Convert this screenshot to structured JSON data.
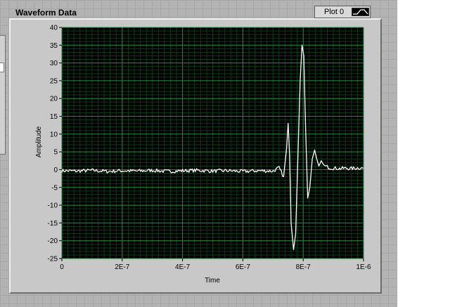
{
  "window": {
    "graph_title": "Waveform Data",
    "legend_label": "Plot 0"
  },
  "colors": {
    "plot_bg": "#000000",
    "major_grid": "#1f8a3a",
    "minor_grid": "#0b3a18",
    "trace": "#ffffff"
  },
  "chart_data": {
    "type": "line",
    "title": "Waveform Data",
    "xlabel": "Time",
    "ylabel": "Amplitude",
    "xlim": [
      0,
      1e-06
    ],
    "ylim": [
      -25,
      40
    ],
    "grid": true,
    "legend": "top-right",
    "x_ticks": [
      0,
      2e-07,
      4e-07,
      6e-07,
      8e-07,
      1e-06
    ],
    "x_tick_labels": [
      "0",
      "2E-7",
      "4E-7",
      "6E-7",
      "8E-7",
      "1E-6"
    ],
    "y_ticks": [
      40,
      35,
      30,
      25,
      20,
      15,
      10,
      5,
      0,
      -5,
      -10,
      -15,
      -20,
      -25
    ],
    "y_tick_labels": [
      "40",
      "35",
      "30",
      "25",
      "20",
      "15",
      "10",
      "5",
      "0",
      "-5",
      "-10",
      "-15",
      "-20",
      "-25"
    ],
    "series": [
      {
        "name": "Plot 0",
        "x": [
          0,
          5e-08,
          1e-07,
          1.5e-07,
          2e-07,
          2.5e-07,
          3e-07,
          3.5e-07,
          4e-07,
          4.5e-07,
          5e-07,
          5.5e-07,
          6e-07,
          6.5e-07,
          7e-07,
          7.2e-07,
          7.35e-07,
          7.45e-07,
          7.5e-07,
          7.55e-07,
          7.6e-07,
          7.68e-07,
          7.75e-07,
          7.83e-07,
          7.9e-07,
          7.96e-07,
          8.02e-07,
          8.08e-07,
          8.15e-07,
          8.22e-07,
          8.3e-07,
          8.38e-07,
          8.45e-07,
          8.52e-07,
          8.6e-07,
          8.7e-07,
          8.8e-07,
          8.9e-07,
          9e-07,
          9.2e-07,
          9.4e-07,
          9.6e-07,
          9.8e-07,
          1e-06
        ],
        "y": [
          -0.3,
          -0.4,
          -0.2,
          -0.5,
          -0.3,
          -0.4,
          -0.2,
          -0.5,
          -0.3,
          -0.2,
          -0.4,
          -0.3,
          -0.5,
          -0.3,
          -0.4,
          0.5,
          -2.0,
          6.0,
          13.0,
          4.0,
          -15.0,
          -22.5,
          -18.0,
          5.0,
          25.0,
          35.0,
          32.0,
          12.0,
          -8.0,
          -5.0,
          3.0,
          5.5,
          3.0,
          1.0,
          2.5,
          1.0,
          0.8,
          0.5,
          0.4,
          0.3,
          0.4,
          0.3,
          0.5,
          0.4
        ]
      }
    ]
  }
}
